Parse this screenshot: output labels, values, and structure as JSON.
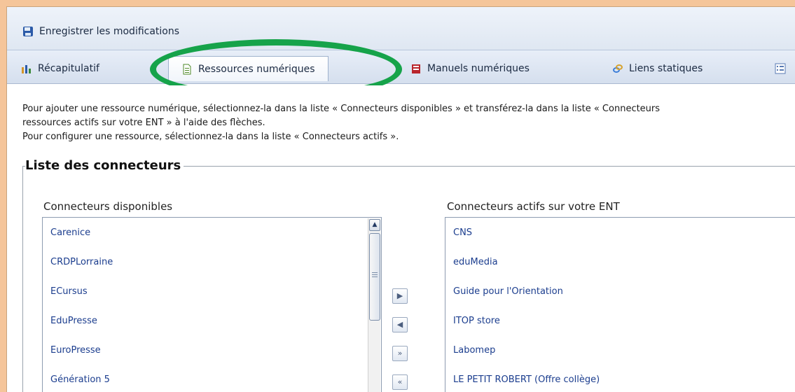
{
  "toolbar": {
    "save_label": "Enregistrer les modifications",
    "save_icon": "save-disk-icon"
  },
  "tabs": [
    {
      "label": "Récapitulatif",
      "icon": "bar-chart-icon"
    },
    {
      "label": "Ressources numériques",
      "icon": "document-icon",
      "active": true
    },
    {
      "label": "Manuels numériques",
      "icon": "book-icon"
    },
    {
      "label": "Liens statiques",
      "icon": "link-icon"
    }
  ],
  "intro": {
    "line1": "Pour ajouter une ressource numérique, sélectionnez-la dans la liste « Connecteurs disponibles » et transférez-la dans la liste « Connecteurs",
    "line2": "ressources actifs sur votre ENT » à l'aide des flèches.",
    "line3": "Pour configurer une ressource, sélectionnez-la dans la liste « Connecteurs actifs »."
  },
  "section": {
    "title": "Liste des connecteurs",
    "available_title": "Connecteurs disponibles",
    "active_title": "Connecteurs actifs sur votre ENT",
    "available": [
      "Carenice",
      "CRDPLorraine",
      "ECursus",
      "EduPresse",
      "EuroPresse",
      "Génération 5"
    ],
    "active": [
      "CNS",
      "eduMedia",
      "Guide pour l'Orientation",
      "ITOP store",
      "Labomep",
      "LE PETIT ROBERT (Offre collège)"
    ]
  },
  "transfer_buttons": [
    {
      "icon": "move-right-icon",
      "glyph": "▶"
    },
    {
      "icon": "move-left-icon",
      "glyph": "◀"
    },
    {
      "icon": "move-all-right-icon",
      "glyph": "»"
    },
    {
      "icon": "move-all-left-icon",
      "glyph": "«"
    }
  ],
  "colors": {
    "highlight": "#16a34a",
    "link": "#1b3d8e",
    "frame": "#f5c59a"
  }
}
